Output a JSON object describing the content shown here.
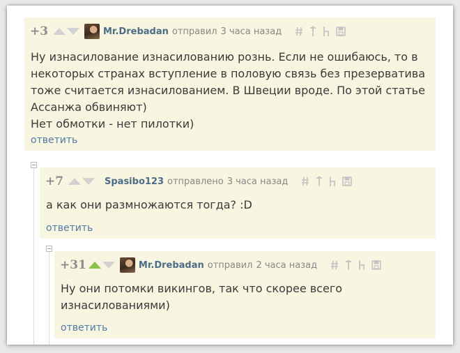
{
  "colors": {
    "comment_background": "#f8f5e0",
    "author": "#4c6c88",
    "reply_link": "#4f7ba6",
    "upvote_active": "#8bc34a",
    "arrow_inactive": "#d2d2d2"
  },
  "icons": [
    "link-icon",
    "arrow-up-icon",
    "parent-icon",
    "save-icon",
    "collapse-icon",
    "avatar"
  ],
  "comments": [
    {
      "rating": "+3",
      "author": "Mr.Drebadan",
      "action": "отправил",
      "time": "3 часа назад",
      "text": "Ну изнасилование изнасилованию рознь. Если не ошибаюсь, то в\nнекоторых странах вступление в половую связь без презерватива\nтоже считается изнасилованием. В Швеции вроде. По этой статье\nАссанжа обвиняют)\nНет обмотки - нет пилотки)",
      "reply": "ответить",
      "upvoted": false
    },
    {
      "rating": "+7",
      "author": "Spasibo123",
      "action": "отправлено",
      "time": "3 часа назад",
      "text": "а как они размножаются тогда? :D",
      "reply": "ответить",
      "upvoted": false
    },
    {
      "rating": "+31",
      "author": "Mr.Drebadan",
      "action": "отправил",
      "time": "2 часа назад",
      "text": "Ну они потомки викингов, так что скорее всего\nизнасилованиями)",
      "reply": "ответить",
      "upvoted": true
    }
  ]
}
